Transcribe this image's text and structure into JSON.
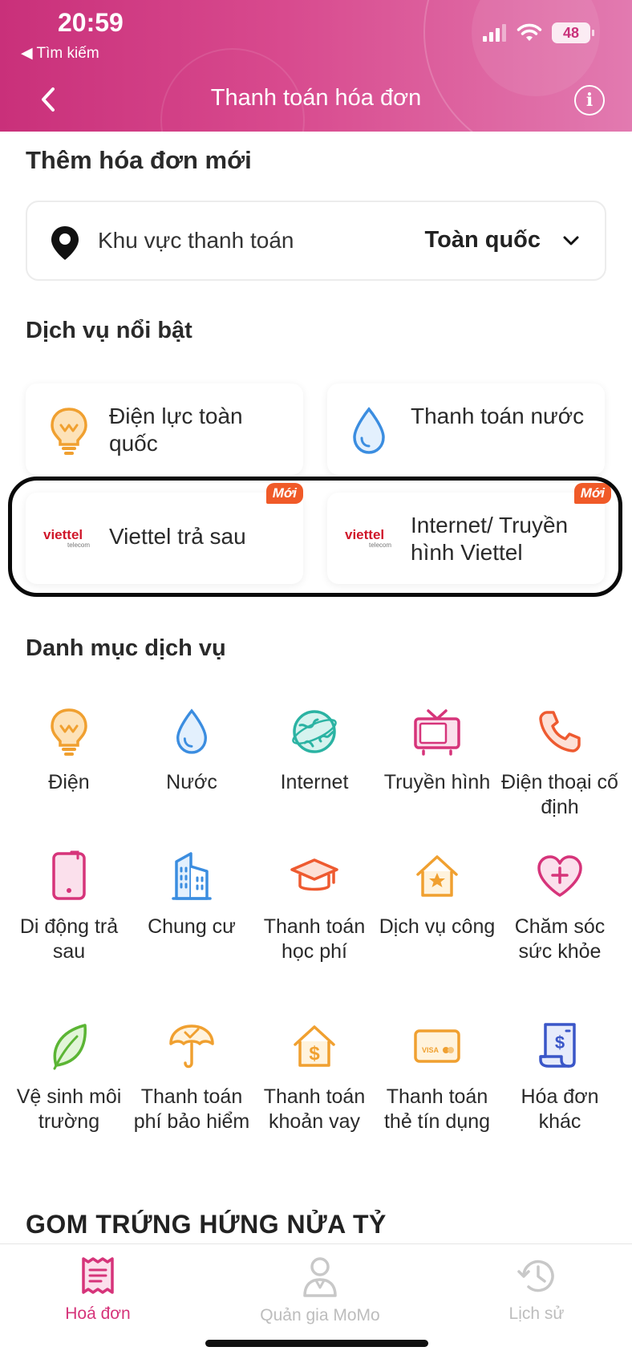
{
  "status_bar": {
    "time": "20:59",
    "back_app": "◀ Tìm kiếm",
    "battery": "48"
  },
  "header": {
    "title": "Thanh toán hóa đơn"
  },
  "new_bill": {
    "title": "Thêm hóa đơn mới",
    "region_label": "Khu vực thanh toán",
    "region_value": "Toàn quốc"
  },
  "featured": {
    "title": "Dịch vụ nổi bật",
    "items": [
      {
        "label": "Điện lực toàn quốc",
        "icon": "lightbulb-icon"
      },
      {
        "label": "Thanh toán nước",
        "icon": "water-drop-icon"
      },
      {
        "label": "Viettel trả sau",
        "icon": "viettel-logo",
        "badge": "Mới"
      },
      {
        "label": "Internet/ Truyền hình Viettel",
        "icon": "viettel-logo",
        "badge": "Mới"
      }
    ],
    "logo_text": "viettel",
    "logo_sub": "telecom"
  },
  "categories": {
    "title": "Danh mục dịch vụ",
    "items": [
      {
        "label": "Điện",
        "icon": "lightbulb-icon"
      },
      {
        "label": "Nước",
        "icon": "water-drop-icon"
      },
      {
        "label": "Internet",
        "icon": "globe-icon"
      },
      {
        "label": "Truyền hình",
        "icon": "tv-icon"
      },
      {
        "label": "Điện thoại cố định",
        "icon": "phone-icon"
      },
      {
        "label": "Di động trả sau",
        "icon": "mobile-icon"
      },
      {
        "label": "Chung cư",
        "icon": "building-icon"
      },
      {
        "label": "Thanh toán học phí",
        "icon": "graduation-cap-icon"
      },
      {
        "label": "Dịch vụ công",
        "icon": "public-service-house-icon"
      },
      {
        "label": "Chăm sóc sức khỏe",
        "icon": "health-heart-icon"
      },
      {
        "label": "Vệ sinh môi trường",
        "icon": "leaf-icon"
      },
      {
        "label": "Thanh toán phí bảo hiểm",
        "icon": "umbrella-icon"
      },
      {
        "label": "Thanh toán khoản vay",
        "icon": "loan-house-icon"
      },
      {
        "label": "Thanh toán thẻ tín dụng",
        "icon": "credit-card-icon"
      },
      {
        "label": "Hóa đơn khác",
        "icon": "receipt-icon"
      }
    ],
    "card_text": "VISA"
  },
  "promo": {
    "title": "GOM TRỨNG HỨNG NỬA TỶ"
  },
  "tabbar": {
    "tabs": [
      {
        "label": "Hoá đơn",
        "icon": "bill-icon",
        "active": true
      },
      {
        "label": "Quản gia MoMo",
        "icon": "butler-icon",
        "active": false
      },
      {
        "label": "Lịch sử",
        "icon": "history-icon",
        "active": false
      }
    ]
  },
  "colors": {
    "brand": "#c9307a",
    "accent_orange": "#f0a030",
    "badge": "#f05a28",
    "viettel_red": "#d0172a"
  }
}
